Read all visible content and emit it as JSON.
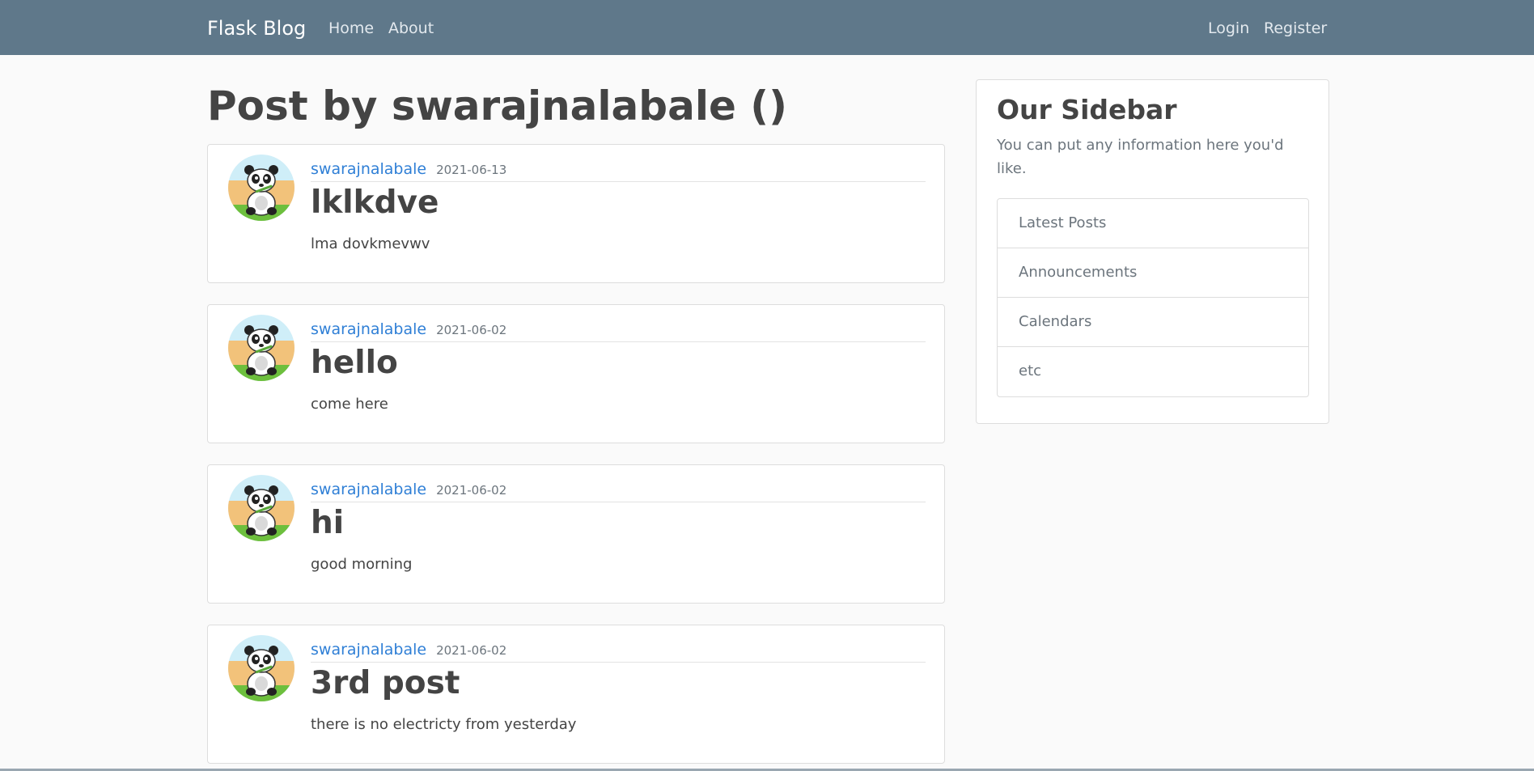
{
  "navbar": {
    "brand": "Flask Blog",
    "left_links": [
      "Home",
      "About"
    ],
    "right_links": [
      "Login",
      "Register"
    ]
  },
  "page_title": "Post by swarajnalabale ()",
  "posts": [
    {
      "author": "swarajnalabale",
      "date": "2021-06-13",
      "title": "lklkdve",
      "content": "lma dovkmevwv",
      "avatar_icon": "panda-avatar-icon"
    },
    {
      "author": "swarajnalabale",
      "date": "2021-06-02",
      "title": "hello",
      "content": "come here",
      "avatar_icon": "panda-avatar-icon"
    },
    {
      "author": "swarajnalabale",
      "date": "2021-06-02",
      "title": "hi",
      "content": "good morning",
      "avatar_icon": "panda-avatar-icon"
    },
    {
      "author": "swarajnalabale",
      "date": "2021-06-02",
      "title": "3rd post",
      "content": "there is no electricty from yesterday",
      "avatar_icon": "panda-avatar-icon"
    }
  ],
  "sidebar": {
    "title": "Our Sidebar",
    "text": "You can put any information here you'd like.",
    "items": [
      "Latest Posts",
      "Announcements",
      "Calendars",
      "etc"
    ]
  },
  "colors": {
    "navbar": "#5f788a",
    "link": "#2f7fd6",
    "background": "#fafafa"
  }
}
